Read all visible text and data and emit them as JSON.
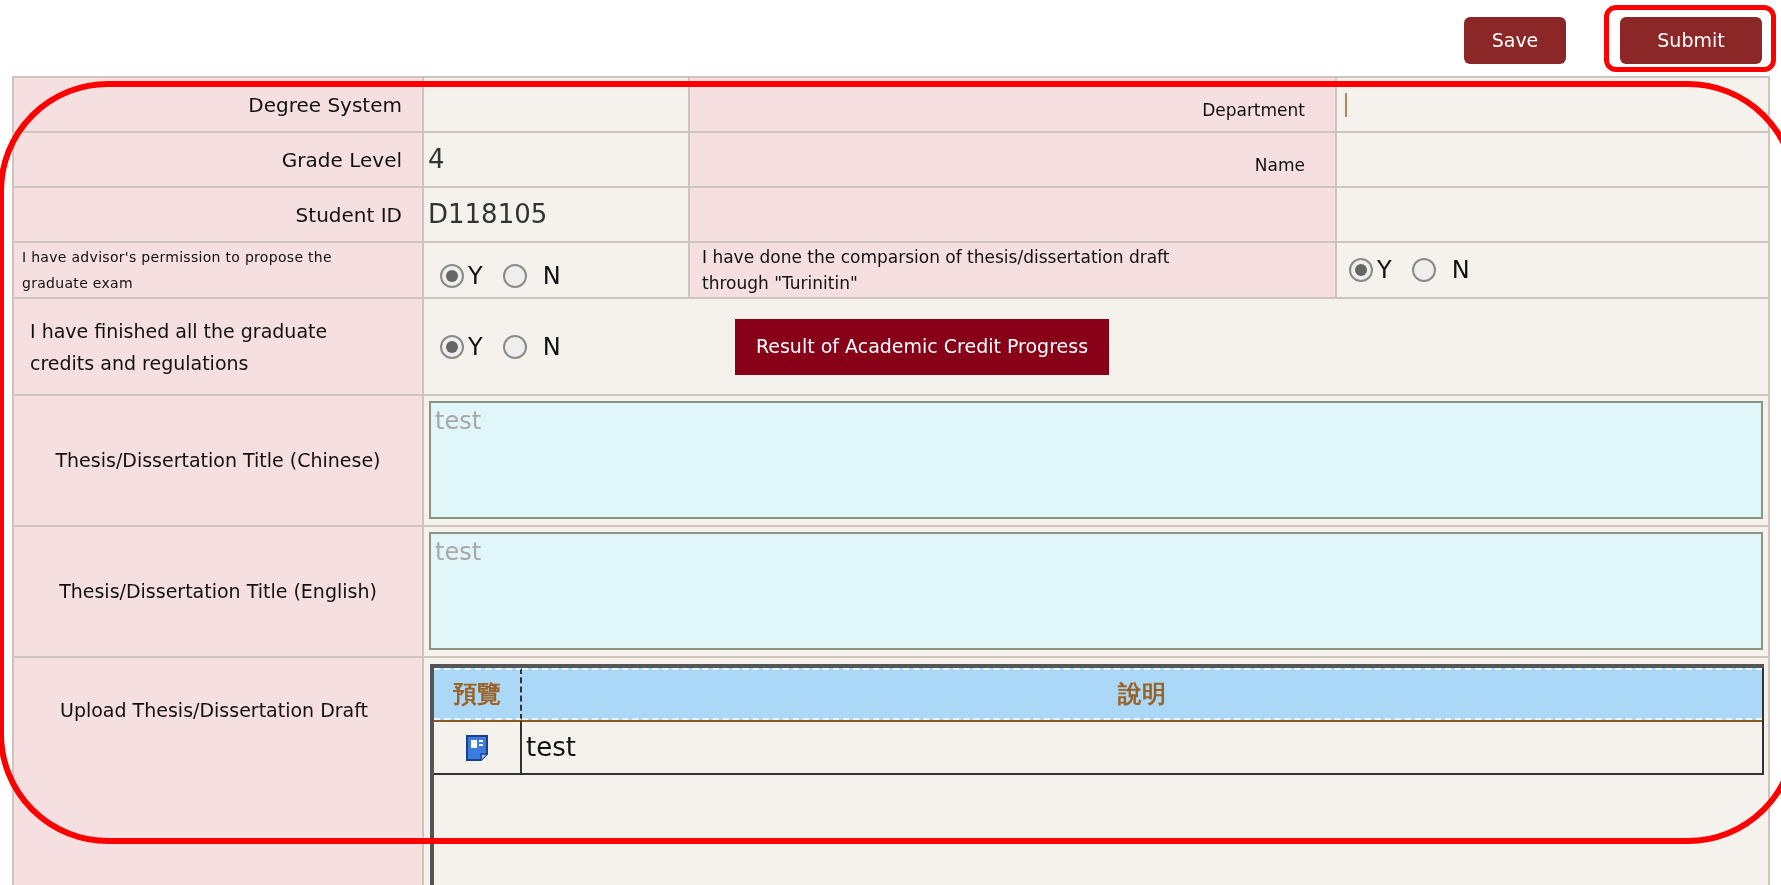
{
  "toolbar": {
    "buttons": [
      {
        "label": "Save",
        "highlighted": false
      },
      {
        "label": "Submit",
        "highlighted": true
      }
    ]
  },
  "form": {
    "highlighted": true,
    "info_rows": [
      {
        "label": "Degree System",
        "value": "",
        "right_label": "Department",
        "right_value": "",
        "right_focused": true
      },
      {
        "label": "Grade Level",
        "value": "4",
        "right_label": "Name",
        "right_value": "",
        "right_focused": false
      },
      {
        "label": "Student ID",
        "value": "D118105",
        "right_label": "",
        "right_value": "",
        "right_focused": false
      }
    ],
    "permission": {
      "label": "I have advisor's permission to propose the graduate exam",
      "options": [
        {
          "label": "Y",
          "selected": true
        },
        {
          "label": "N",
          "selected": false
        }
      ]
    },
    "comparison": {
      "label": "I have done the comparsion of thesis/dissertation draft through \"Turinitin\"",
      "options": [
        {
          "label": "Y",
          "selected": true
        },
        {
          "label": "N",
          "selected": false
        }
      ]
    },
    "credits": {
      "label": "I have finished all the graduate credits and regulations",
      "options": [
        {
          "label": "Y",
          "selected": true
        },
        {
          "label": "N",
          "selected": false
        }
      ],
      "button": "Result of Academic Credit Progress"
    },
    "title_fields": [
      {
        "label": "Thesis/Dissertation Title (Chinese)",
        "placeholder": "test"
      },
      {
        "label": "Thesis/Dissertation Title (English)",
        "placeholder": "test"
      }
    ],
    "upload": {
      "label": "Upload Thesis/Dissertation Draft",
      "columns": [
        "預覽",
        "說明"
      ],
      "rows": [
        {
          "description": "test"
        }
      ]
    }
  }
}
